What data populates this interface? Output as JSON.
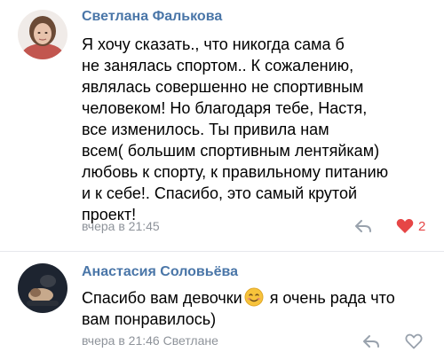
{
  "comments": [
    {
      "author": "Светлана Фалькова",
      "lines": [
        "Я хочу сказать., что никогда сама б",
        "не занялась спортом.. К сожалению,",
        "являлась совершенно не спортивным",
        "человеком! Но благодаря тебе,  Настя,",
        "все изменилось. Ты привила нам",
        "всем( большим спортивным лентяйкам)",
        "любовь к спорту, к правильному питанию",
        "и к себе!. Спасибо, это самый крутой",
        "проект!"
      ],
      "timestamp": "вчера в 21:45",
      "likes": "2",
      "liked": true
    },
    {
      "author": "Анастасия Соловьёва",
      "line1_before_emoji": "Спасибо вам девочки",
      "line1_after_emoji": " я очень рада что",
      "line2": "вам понравилось)",
      "emoji": "smiling-face-emoji",
      "timestamp": "вчера в 21:46 Светлане",
      "liked": false
    }
  ],
  "colors": {
    "author": "#4a76a8",
    "meta": "#8e939a",
    "like_active": "#e64646",
    "icon": "#99a2ad"
  },
  "icons": {
    "reply": "reply-arrow-icon",
    "like": "heart-icon"
  }
}
